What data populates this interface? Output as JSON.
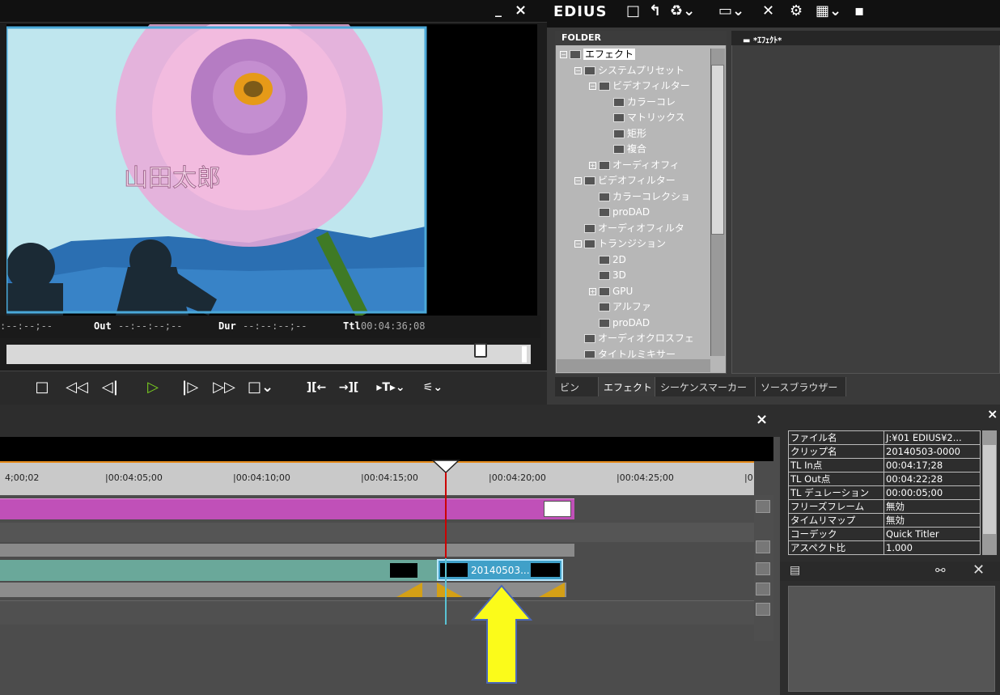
{
  "window": {
    "minimize": "_",
    "close": "×"
  },
  "player": {
    "overlay_text": "山田太郎",
    "tc_in": ":--:--;--",
    "out_label": "Out",
    "tc_out": "--:--:--;--",
    "dur_label": "Dur",
    "tc_dur": "--:--:--;--",
    "ttl_label": "Ttl",
    "tc_ttl": "00:04:36;08",
    "play_color": "#7cd31f"
  },
  "bin": {
    "app_title": "EDIUS",
    "folder_header": "FOLDER",
    "effect_header": "*ｴﾌｪｸﾄ*",
    "tree": [
      {
        "label": "エフェクト",
        "indent": 0,
        "box": "−"
      },
      {
        "label": "システムプリセット",
        "indent": 1,
        "box": "−"
      },
      {
        "label": "ビデオフィルター",
        "indent": 2,
        "box": "−"
      },
      {
        "label": "カラーコレ",
        "indent": 3,
        "box": ""
      },
      {
        "label": "マトリックス",
        "indent": 3,
        "box": ""
      },
      {
        "label": "矩形",
        "indent": 3,
        "box": ""
      },
      {
        "label": "複合",
        "indent": 3,
        "box": ""
      },
      {
        "label": "オーディオフィ",
        "indent": 2,
        "box": "+"
      },
      {
        "label": "ビデオフィルター",
        "indent": 1,
        "box": "−"
      },
      {
        "label": "カラーコレクショ",
        "indent": 2,
        "box": ""
      },
      {
        "label": "proDAD",
        "indent": 2,
        "box": ""
      },
      {
        "label": "オーディオフィルタ",
        "indent": 1,
        "box": ""
      },
      {
        "label": "トランジション",
        "indent": 1,
        "box": "−"
      },
      {
        "label": "2D",
        "indent": 2,
        "box": ""
      },
      {
        "label": "3D",
        "indent": 2,
        "box": ""
      },
      {
        "label": "GPU",
        "indent": 2,
        "box": "+"
      },
      {
        "label": "アルファ",
        "indent": 2,
        "box": ""
      },
      {
        "label": "proDAD",
        "indent": 2,
        "box": ""
      },
      {
        "label": "オーディオクロスフェ",
        "indent": 1,
        "box": ""
      },
      {
        "label": "タイトルミキサー",
        "indent": 1,
        "box": ""
      }
    ],
    "tabs": [
      "ビン",
      "エフェクト",
      "シーケンスマーカー",
      "ソースブラウザー"
    ]
  },
  "timeline": {
    "close": "×",
    "ruler": [
      "4;00;02",
      "|00:04:05;00",
      "|00:04:10;00",
      "|00:04:15;00",
      "|00:04:20;00",
      "|00:04:25;00",
      "|0"
    ],
    "selected_clip": "20140503..."
  },
  "info": {
    "close": "×",
    "rows": [
      [
        "ファイル名",
        "J:¥01 EDIUS¥2..."
      ],
      [
        "クリップ名",
        "20140503-0000"
      ],
      [
        "TL In点",
        "00:04:17;28"
      ],
      [
        "TL Out点",
        "00:04:22;28"
      ],
      [
        "TL デュレーション",
        "00:00:05;00"
      ],
      [
        "フリーズフレーム",
        "無効"
      ],
      [
        "タイムリマップ",
        "無効"
      ],
      [
        "コーデック",
        "Quick Titler"
      ],
      [
        "アスペクト比",
        "1.000"
      ]
    ]
  }
}
